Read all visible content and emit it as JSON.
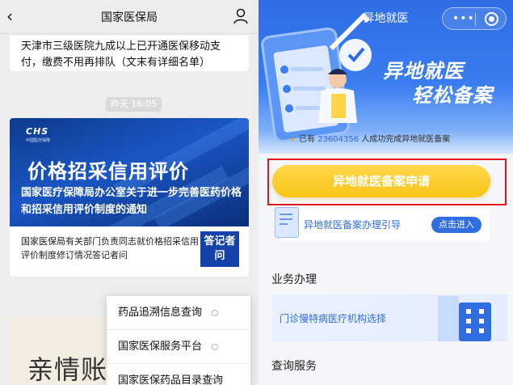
{
  "left": {
    "nav": {
      "title": "国家医保局"
    },
    "article_tail": "天津市三级医院九成以上已开通医保移动支付，缴费不用再排队（文末有详细名单）",
    "time": "昨天 16:05",
    "news": {
      "logo": "CHS",
      "logo_sub": "中国医疗保障",
      "banner_title": "价格招采信用评价",
      "banner_subtitle": "国家医疗保障局办公室关于进一步完善医药价格和招采信用评价制度的通知",
      "summary": "国家医保局有关部门负责同志就价格招采信用评价制度修订情况答记者问",
      "badge": "答记者问"
    },
    "card3_text": "亲情账",
    "menu": [
      "药品追溯信息查询",
      "国家医保服务平台",
      "国家医保药品目录查询"
    ]
  },
  "right": {
    "nav": {
      "title": "异地就医",
      "more": "•••"
    },
    "hero": {
      "line1": "异地就医",
      "line2": "轻松备案"
    },
    "notice": {
      "prefix": "已有",
      "count": "23604356",
      "suffix": "人成功完成异地就医备案"
    },
    "apply_button": "异地就医备案申请",
    "guide": {
      "label": "异地就医备案办理引导",
      "button": "点击进入"
    },
    "section1": "业务办理",
    "service": "门诊慢特病医疗机构选择",
    "section2": "查询服务"
  },
  "colors": {
    "accent": "#2f6de0",
    "cta": "#f8c417",
    "highlight": "#e3141b"
  }
}
